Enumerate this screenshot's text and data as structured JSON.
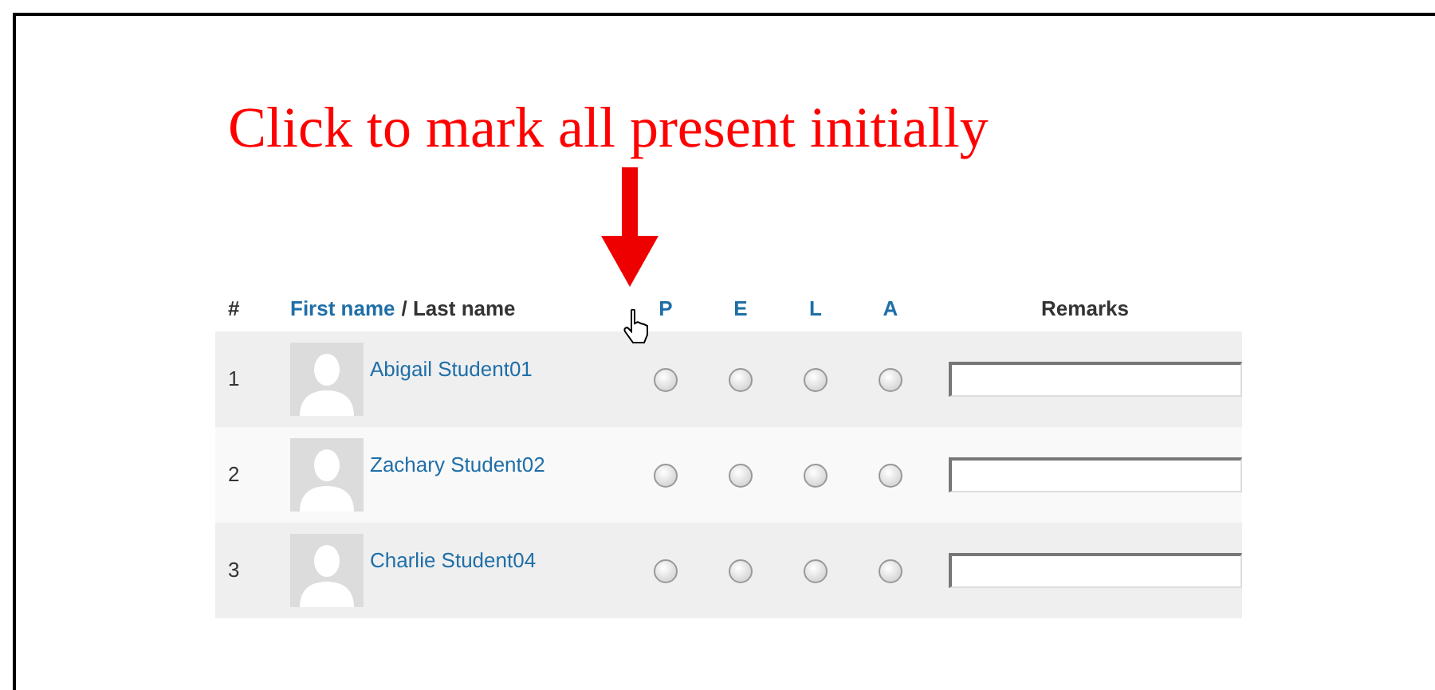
{
  "annotation": "Click to mark all present initially",
  "header": {
    "number": "#",
    "first_name": "First name",
    "last_name": "/ Last name",
    "statuses": [
      "P",
      "E",
      "L",
      "A"
    ],
    "remarks": "Remarks"
  },
  "rows": [
    {
      "number": "1",
      "name": "Abigail Student01",
      "statuses": [
        {
          "selected": false
        },
        {
          "selected": false
        },
        {
          "selected": false
        },
        {
          "selected": false
        }
      ]
    },
    {
      "number": "2",
      "name": "Zachary Student02",
      "statuses": [
        {
          "selected": false
        },
        {
          "selected": false
        },
        {
          "selected": false
        },
        {
          "selected": false
        }
      ]
    },
    {
      "number": "3",
      "name": "Charlie Student04",
      "statuses": [
        {
          "selected": false
        },
        {
          "selected": false
        },
        {
          "selected": false
        },
        {
          "selected": false
        }
      ]
    }
  ]
}
